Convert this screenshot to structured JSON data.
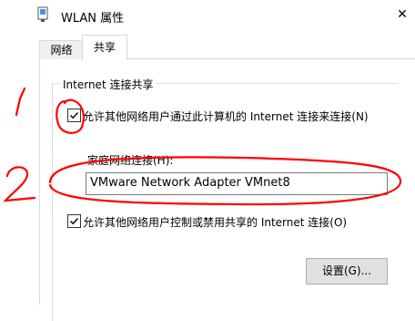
{
  "window": {
    "title": "WLAN 属性",
    "close_glyph": "✕"
  },
  "tabs": [
    {
      "label": "网络"
    },
    {
      "label": "共享"
    }
  ],
  "group": {
    "title": "Internet 连接共享",
    "allow_share_label": "允许其他网络用户通过此计算机的 Internet 连接来连接(N)",
    "allow_share_checked": true,
    "home_connection_label": "家庭网络连接(H):",
    "home_connection_value": "VMware Network Adapter VMnet8",
    "allow_control_label": "允许其他网络用户控制或禁用共享的 Internet 连接(O)",
    "allow_control_checked": true,
    "settings_button": "设置(G)..."
  },
  "annotations": {
    "color": "#ff0000",
    "number1": "1",
    "number2": "2"
  }
}
